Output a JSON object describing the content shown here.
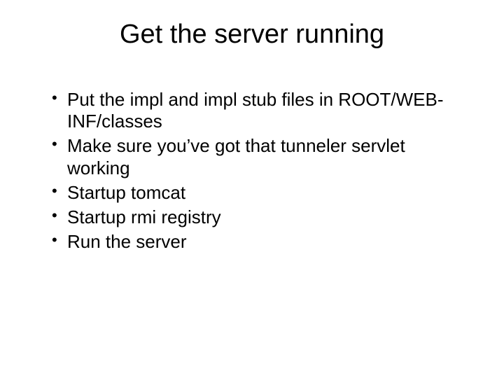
{
  "slide": {
    "title": "Get the server running",
    "bullets": [
      "Put the impl and impl stub files in ROOT/WEB-INF/classes",
      "Make sure you’ve got that tunneler servlet working",
      "Startup tomcat",
      "Startup rmi registry",
      "Run the server"
    ]
  }
}
